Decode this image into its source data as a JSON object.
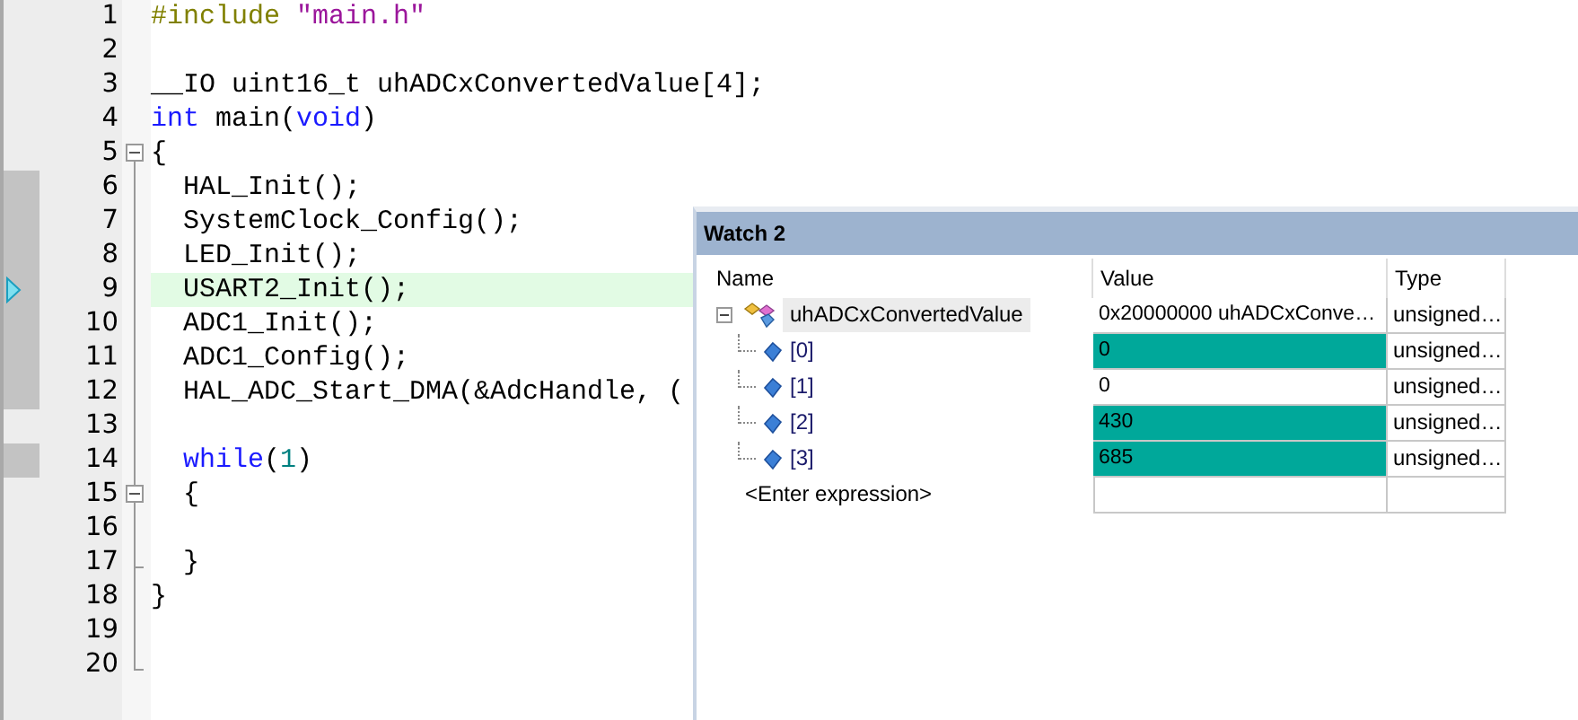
{
  "editor": {
    "lines": [
      {
        "number": "1",
        "collapsible": false,
        "block_end": false,
        "executed": false,
        "current": false,
        "tokens": [
          {
            "kind": "preproc",
            "text": "#include"
          },
          {
            "kind": "string",
            "text": " \"main.h\""
          }
        ]
      },
      {
        "number": "2",
        "collapsible": false,
        "block_end": false,
        "executed": false,
        "current": false
      },
      {
        "number": "3",
        "collapsible": false,
        "block_end": false,
        "executed": false,
        "current": false,
        "tokens": [
          {
            "kind": "plain",
            "text": "__IO uint16_t uhADCxConvertedValue[4];"
          }
        ]
      },
      {
        "number": "4",
        "collapsible": false,
        "block_end": false,
        "executed": false,
        "current": false,
        "tokens": [
          {
            "kind": "keyword",
            "text": "int"
          },
          {
            "kind": "plain",
            "text": " main("
          },
          {
            "kind": "keyword",
            "text": "void"
          },
          {
            "kind": "plain",
            "text": ")"
          }
        ]
      },
      {
        "number": "5",
        "collapsible": true,
        "block_end": false,
        "executed": false,
        "current": false,
        "tokens": [
          {
            "kind": "plain",
            "text": "{"
          }
        ]
      },
      {
        "number": "6",
        "collapsible": false,
        "block_end": false,
        "executed": true,
        "current": false,
        "tokens": [
          {
            "kind": "plain",
            "text": "  HAL_Init();"
          }
        ]
      },
      {
        "number": "7",
        "collapsible": false,
        "block_end": false,
        "executed": true,
        "current": false,
        "tokens": [
          {
            "kind": "plain",
            "text": "  SystemClock_Config();"
          }
        ]
      },
      {
        "number": "8",
        "collapsible": false,
        "block_end": false,
        "executed": true,
        "current": false,
        "tokens": [
          {
            "kind": "plain",
            "text": "  LED_Init();"
          }
        ]
      },
      {
        "number": "9",
        "collapsible": false,
        "block_end": false,
        "executed": true,
        "current": true,
        "tokens": [
          {
            "kind": "plain",
            "text": "  USART2_Init();"
          }
        ]
      },
      {
        "number": "10",
        "collapsible": false,
        "block_end": false,
        "executed": true,
        "current": false,
        "tokens": [
          {
            "kind": "plain",
            "text": "  ADC1_Init();"
          }
        ]
      },
      {
        "number": "11",
        "collapsible": false,
        "block_end": false,
        "executed": true,
        "current": false,
        "tokens": [
          {
            "kind": "plain",
            "text": "  ADC1_Config();"
          }
        ]
      },
      {
        "number": "12",
        "collapsible": false,
        "block_end": false,
        "executed": true,
        "current": false,
        "tokens": [
          {
            "kind": "plain",
            "text": "  HAL_ADC_Start_DMA(&AdcHandle, ("
          }
        ]
      },
      {
        "number": "13",
        "collapsible": false,
        "block_end": false,
        "executed": false,
        "current": false
      },
      {
        "number": "14",
        "collapsible": false,
        "block_end": false,
        "executed": true,
        "current": false,
        "tokens": [
          {
            "kind": "keyword",
            "text": "  while"
          },
          {
            "kind": "plain",
            "text": "("
          },
          {
            "kind": "number",
            "text": "1"
          },
          {
            "kind": "plain",
            "text": ")"
          }
        ]
      },
      {
        "number": "15",
        "collapsible": true,
        "block_end": false,
        "executed": false,
        "current": false,
        "tokens": [
          {
            "kind": "plain",
            "text": "  {"
          }
        ]
      },
      {
        "number": "16",
        "collapsible": false,
        "block_end": false,
        "executed": false,
        "current": false
      },
      {
        "number": "17",
        "collapsible": false,
        "block_end": true,
        "executed": false,
        "current": false,
        "tokens": [
          {
            "kind": "plain",
            "text": "  }"
          }
        ]
      },
      {
        "number": "18",
        "collapsible": false,
        "block_end": false,
        "executed": false,
        "current": false,
        "tokens": [
          {
            "kind": "plain",
            "text": "}"
          }
        ]
      },
      {
        "number": "19",
        "collapsible": false,
        "block_end": false,
        "executed": false,
        "current": false
      },
      {
        "number": "20",
        "collapsible": false,
        "block_end": true,
        "executed": false,
        "current": false
      }
    ]
  },
  "watch": {
    "title": "Watch 2",
    "columns": [
      "Name",
      "Value",
      "Type"
    ],
    "root": {
      "name": "uhADCxConvertedValue",
      "value": "0x20000000 uhADCxConve…",
      "type": "unsigned…",
      "expanded": true,
      "selected": true,
      "children": [
        {
          "name": "[0]",
          "value": "0",
          "type": "unsigned…",
          "changed": true
        },
        {
          "name": "[1]",
          "value": "0",
          "type": "unsigned…",
          "changed": false
        },
        {
          "name": "[2]",
          "value": "430",
          "type": "unsigned…",
          "changed": true
        },
        {
          "name": "[3]",
          "value": "685",
          "type": "unsigned…",
          "changed": true
        }
      ]
    },
    "placeholder": "<Enter expression>"
  }
}
